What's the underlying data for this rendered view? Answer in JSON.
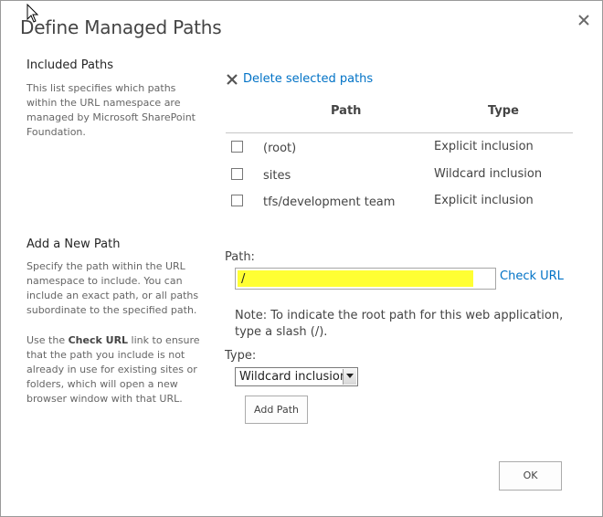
{
  "dialog": {
    "title": "Define Managed Paths",
    "close_icon": "close-icon"
  },
  "included_paths": {
    "section_title": "Included Paths",
    "description": "This list specifies which paths within the URL namespace are managed by Microsoft SharePoint Foundation.",
    "delete_link": "Delete selected paths",
    "columns": {
      "path": "Path",
      "type": "Type"
    },
    "rows": [
      {
        "path": "(root)",
        "type": "Explicit inclusion",
        "checked": false
      },
      {
        "path": "sites",
        "type": "Wildcard inclusion",
        "checked": false
      },
      {
        "path": "tfs/development team",
        "type": "Explicit inclusion",
        "checked": false
      }
    ]
  },
  "add_path": {
    "section_title": "Add a New Path",
    "description_1": "Specify the path within the URL namespace to include. You can include an exact path, or all paths subordinate to the specified path.",
    "description_2_pre": "Use the ",
    "description_2_bold": "Check URL",
    "description_2_post": " link to ensure that the path you include is not already in use for existing sites or folders, which will open a new browser window with that URL.",
    "path_label": "Path:",
    "path_value": "/",
    "check_url": "Check URL",
    "note": "Note: To indicate the root path for this web application, type a slash (/).",
    "type_label": "Type:",
    "type_selected": "Wildcard inclusion",
    "add_button": "Add Path"
  },
  "footer": {
    "ok_button": "OK"
  },
  "colors": {
    "link": "#0072c6",
    "highlight": "#ffff33",
    "text": "#444444"
  }
}
